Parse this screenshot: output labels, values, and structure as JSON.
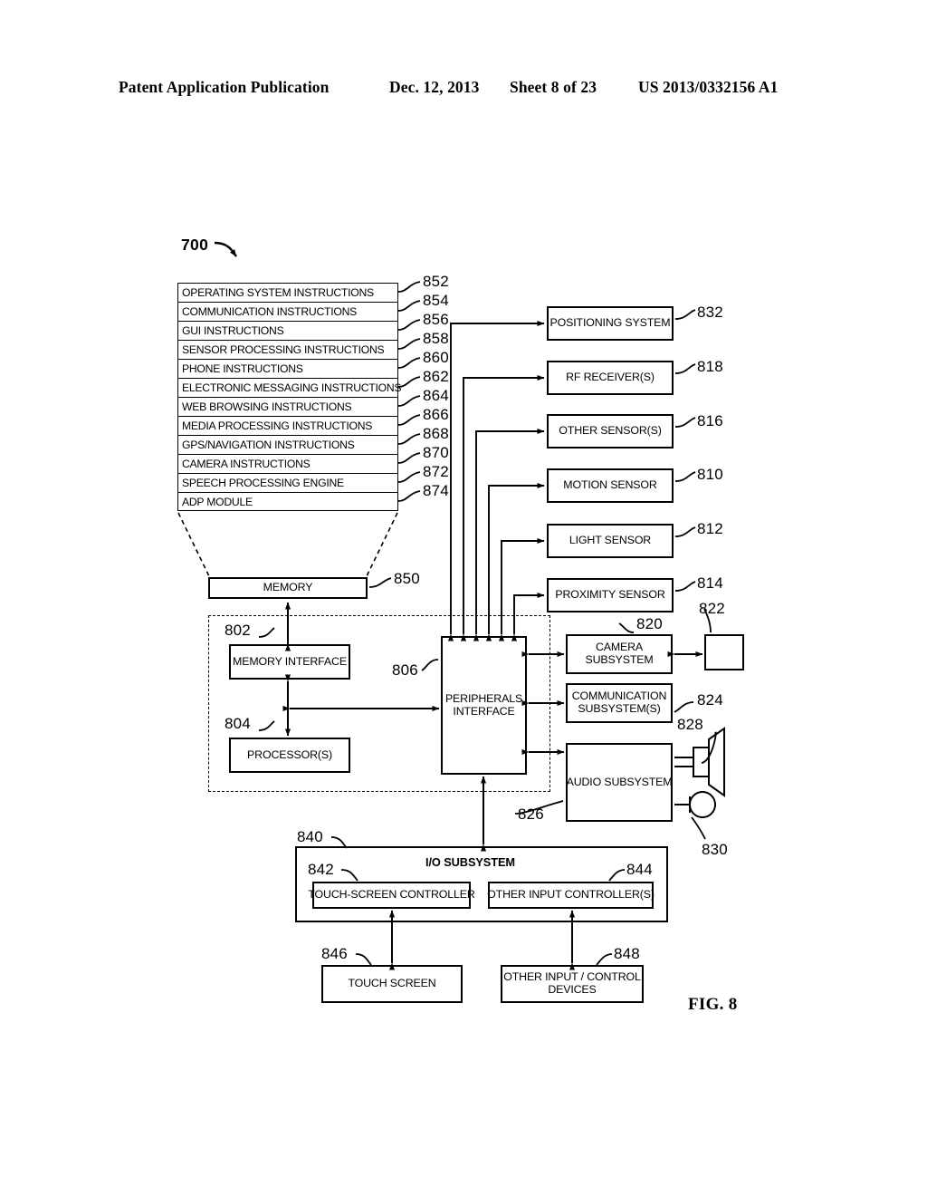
{
  "header": {
    "publication": "Patent Application Publication",
    "date": "Dec. 12, 2013",
    "sheet": "Sheet 8 of 23",
    "number": "US 2013/0332156 A1"
  },
  "figure": {
    "label": "FIG. 8",
    "system_ref": "700"
  },
  "memory_instructions": {
    "memory_label": "MEMORY",
    "memory_ref": "850",
    "rows": [
      {
        "label": "OPERATING SYSTEM INSTRUCTIONS",
        "ref": "852"
      },
      {
        "label": "COMMUNICATION INSTRUCTIONS",
        "ref": "854"
      },
      {
        "label": "GUI INSTRUCTIONS",
        "ref": "856"
      },
      {
        "label": "SENSOR PROCESSING INSTRUCTIONS",
        "ref": "858"
      },
      {
        "label": "PHONE INSTRUCTIONS",
        "ref": "860"
      },
      {
        "label": "ELECTRONIC MESSAGING INSTRUCTIONS",
        "ref": "862"
      },
      {
        "label": "WEB BROWSING INSTRUCTIONS",
        "ref": "864"
      },
      {
        "label": "MEDIA PROCESSING INSTRUCTIONS",
        "ref": "866"
      },
      {
        "label": "GPS/NAVIGATION INSTRUCTIONS",
        "ref": "868"
      },
      {
        "label": "CAMERA INSTRUCTIONS",
        "ref": "870"
      },
      {
        "label": "SPEECH PROCESSING ENGINE",
        "ref": "872"
      },
      {
        "label": "ADP MODULE",
        "ref": "874"
      }
    ]
  },
  "sensors": [
    {
      "label": "POSITIONING SYSTEM",
      "ref": "832"
    },
    {
      "label": "RF RECEIVER(S)",
      "ref": "818"
    },
    {
      "label": "OTHER SENSOR(S)",
      "ref": "816"
    },
    {
      "label": "MOTION SENSOR",
      "ref": "810"
    },
    {
      "label": "LIGHT SENSOR",
      "ref": "812"
    },
    {
      "label": "PROXIMITY SENSOR",
      "ref": "814"
    }
  ],
  "core": {
    "memory_interface": {
      "label": "MEMORY INTERFACE",
      "ref": "802"
    },
    "processors": {
      "label": "PROCESSOR(S)",
      "ref": "804"
    },
    "peripherals": {
      "label": "PERIPHERALS\nINTERFACE",
      "label_line1": "PERIPHERALS",
      "label_line2": "INTERFACE",
      "ref": "806"
    }
  },
  "subsystems": {
    "camera": {
      "label_line1": "CAMERA",
      "label_line2": "SUBSYSTEM",
      "ref": "820"
    },
    "optical_sensor": {
      "label": "",
      "ref": "822"
    },
    "communication": {
      "label_line1": "COMMUNICATION",
      "label_line2": "SUBSYSTEM(S)",
      "ref": "824"
    },
    "audio": {
      "label": "AUDIO SUBSYSTEM",
      "ref": "826"
    },
    "speaker": {
      "ref": "828",
      "icon": "speaker-icon"
    },
    "microphone": {
      "ref": "830",
      "icon": "microphone-icon"
    }
  },
  "io_subsystem": {
    "title": "I/O SUBSYSTEM",
    "ref": "840",
    "touch_controller": {
      "label": "TOUCH-SCREEN CONTROLLER",
      "ref": "842"
    },
    "other_input_controller": {
      "label": "OTHER INPUT CONTROLLER(S)",
      "ref": "844"
    },
    "touch_screen": {
      "label": "TOUCH SCREEN",
      "ref": "846"
    },
    "other_devices": {
      "label_line1": "OTHER INPUT / CONTROL",
      "label_line2": "DEVICES",
      "ref": "848"
    }
  }
}
